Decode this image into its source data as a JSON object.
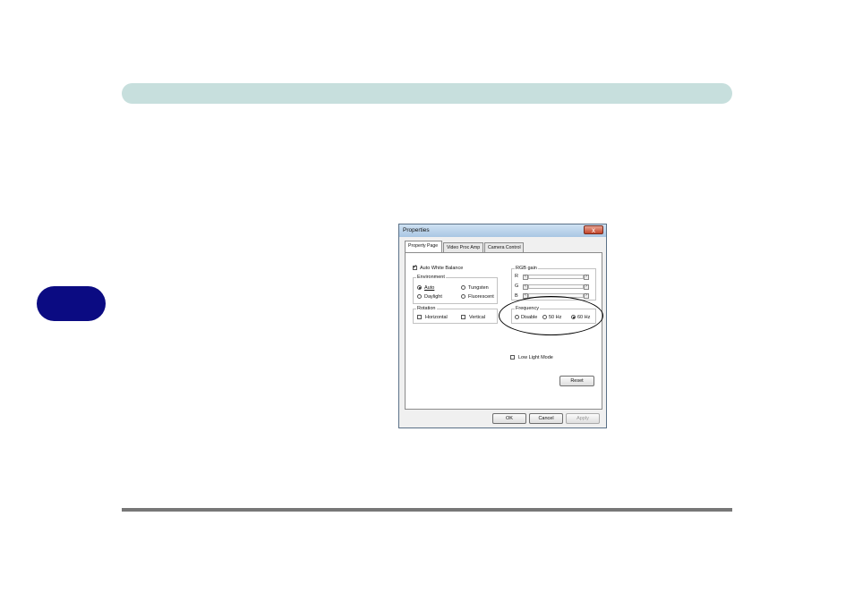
{
  "dialog": {
    "title": "Properties",
    "close_label": "x",
    "tabs": [
      "Property Page",
      "Video Proc Amp",
      "Camera Control"
    ],
    "auto_white_balance": {
      "label": "Auto White Balance",
      "checked": true
    },
    "environment": {
      "label": "Environment",
      "options": [
        "Auto",
        "Tungsten",
        "Daylight",
        "Fluorescent"
      ],
      "selected": "Auto"
    },
    "rgb_gain": {
      "label": "RGB gain",
      "channels": [
        "R",
        "G",
        "B"
      ]
    },
    "rotation": {
      "label": "Rotation",
      "options": [
        "Horizontal",
        "Vertical"
      ]
    },
    "frequency": {
      "label": "Frequency",
      "options": [
        "Disable",
        "50 Hz",
        "60 Hz"
      ],
      "selected": "60 Hz"
    },
    "low_light_mode": {
      "label": "Low Light Mode",
      "checked": false
    },
    "reset_label": "Reset",
    "ok_label": "OK",
    "cancel_label": "Cancel",
    "apply_label": "Apply"
  },
  "colors": {
    "top_band": "#c7dfdd",
    "chapter_tab": "#0b0b82",
    "bottom_rule": "#777777"
  }
}
